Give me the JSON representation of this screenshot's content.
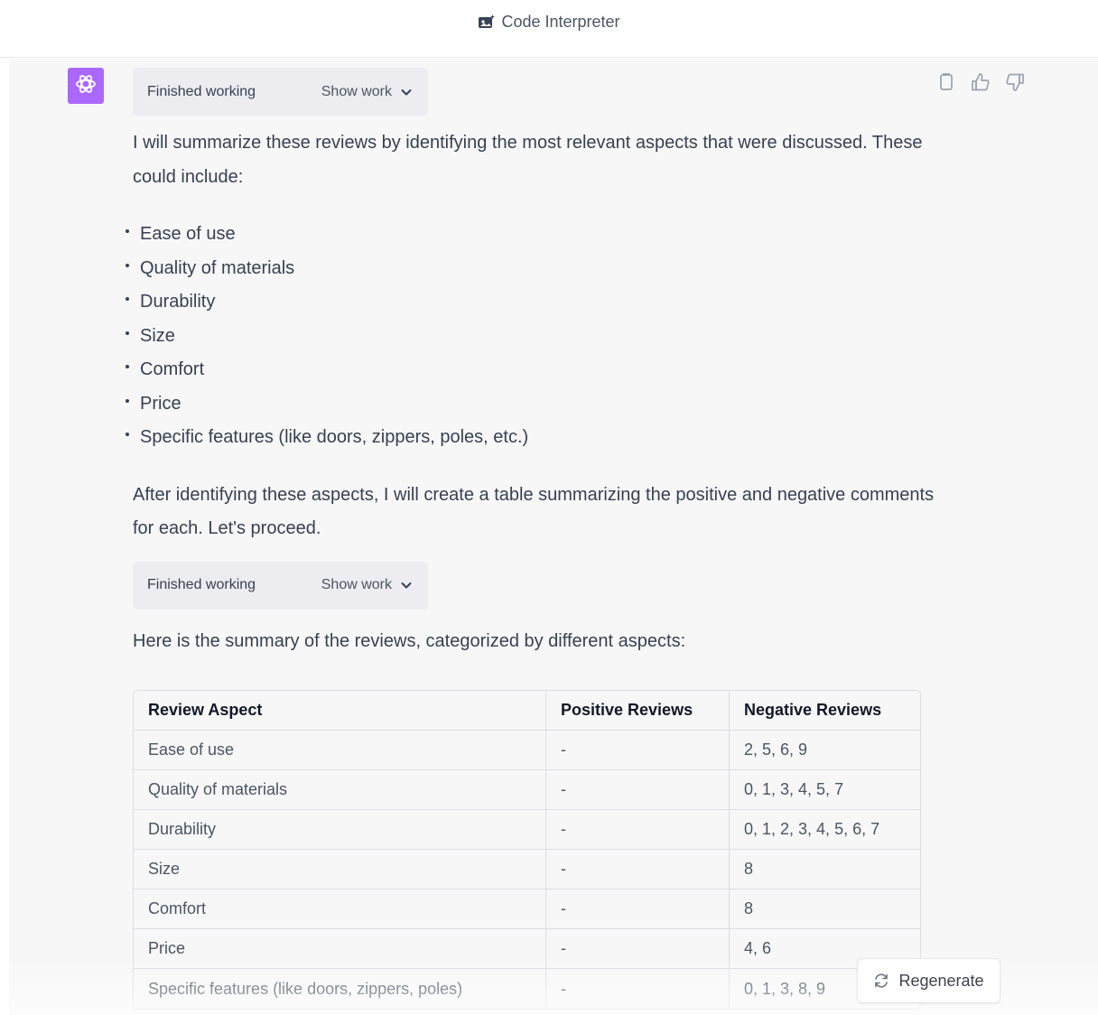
{
  "header": {
    "title": "Code Interpreter",
    "icon": "code-interpreter-icon"
  },
  "message": {
    "avatar_icon": "openai-logo-icon",
    "work_blocks": [
      {
        "status": "Finished working",
        "toggle_label": "Show work"
      },
      {
        "status": "Finished working",
        "toggle_label": "Show work"
      }
    ],
    "intro": "I will summarize these reviews by identifying the most relevant aspects that were discussed. These could include:",
    "aspects": [
      "Ease of use",
      "Quality of materials",
      "Durability",
      "Size",
      "Comfort",
      "Price",
      "Specific features (like doors, zippers, poles, etc.)"
    ],
    "followup": "After identifying these aspects, I will create a table summarizing the positive and negative comments for each. Let's proceed.",
    "summary_intro": "Here is the summary of the reviews, categorized by different aspects:",
    "table": {
      "headers": [
        "Review Aspect",
        "Positive Reviews",
        "Negative Reviews"
      ],
      "rows": [
        [
          "Ease of use",
          "-",
          "2, 5, 6, 9"
        ],
        [
          "Quality of materials",
          "-",
          "0, 1, 3, 4, 5, 7"
        ],
        [
          "Durability",
          "-",
          "0, 1, 2, 3, 4, 5, 6, 7"
        ],
        [
          "Size",
          "-",
          "8"
        ],
        [
          "Comfort",
          "-",
          "8"
        ],
        [
          "Price",
          "-",
          "4, 6"
        ],
        [
          "Specific features (like doors, zippers, poles)",
          "-",
          "0, 1, 3, 8, 9"
        ]
      ]
    },
    "actions": [
      "copy-icon",
      "thumbs-up-icon",
      "thumbs-down-icon"
    ]
  },
  "regenerate": {
    "label": "Regenerate",
    "icon": "refresh-icon"
  }
}
